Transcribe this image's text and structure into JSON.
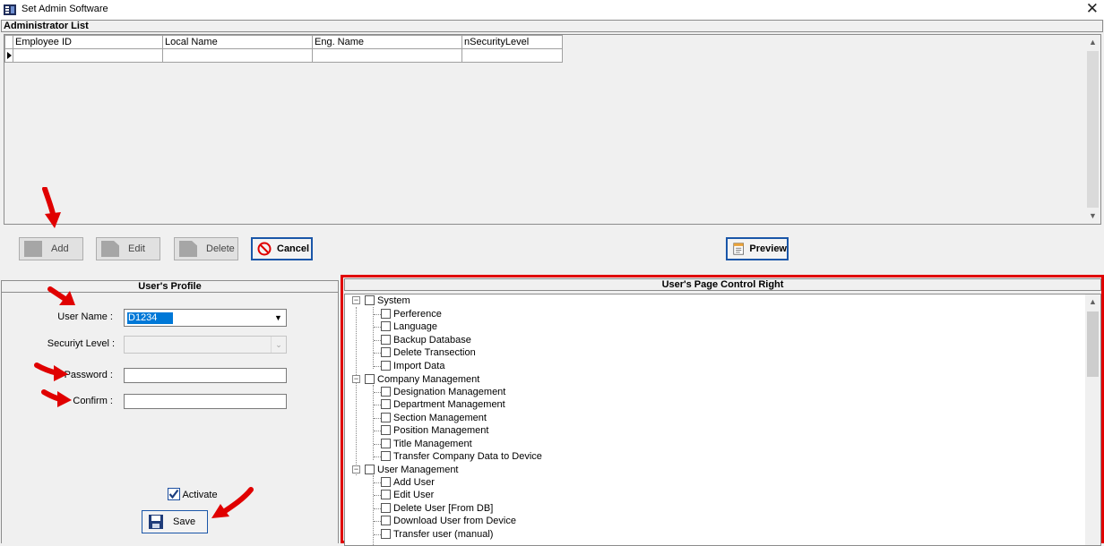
{
  "window": {
    "title": "Set Admin Software",
    "close": "✕"
  },
  "admin_list": {
    "title": "Administrator List",
    "columns": [
      "Employee ID",
      "Local Name",
      "Eng. Name",
      "nSecurityLevel"
    ],
    "rows": [
      [
        "",
        "",
        "",
        ""
      ]
    ],
    "scroll_up": "▲",
    "scroll_down": "▼"
  },
  "toolbar": {
    "add": "Add",
    "edit": "Edit",
    "delete": "Delete",
    "cancel": "Cancel",
    "preview": "Preview"
  },
  "profile": {
    "title": "User's Profile",
    "user_name_label": "User Name :",
    "user_name_value": "D1234",
    "security_label": "Securiyt Level :",
    "security_value": "",
    "password_label": "Password :",
    "confirm_label": "Confirm :",
    "activate_label": "Activate",
    "activate_checked": true,
    "save": "Save"
  },
  "rights": {
    "title": "User's Page Control Right",
    "groups": [
      {
        "label": "System",
        "items": [
          "Perference",
          "Language",
          "Backup Database",
          "Delete Transection",
          "Import Data"
        ]
      },
      {
        "label": "Company Management",
        "items": [
          "Designation Management",
          "Department Management",
          "Section Management",
          "Position Management",
          "Title Management",
          "Transfer Company Data to Device"
        ]
      },
      {
        "label": "User Management",
        "items": [
          "Add User",
          "Edit User",
          "Delete User [From DB]",
          "Download User from Device",
          "Transfer user (manual)"
        ]
      }
    ]
  },
  "colors": {
    "highlight": "#0078d7",
    "annotation_red": "#e00000",
    "button_focus": "#1a56a8"
  }
}
